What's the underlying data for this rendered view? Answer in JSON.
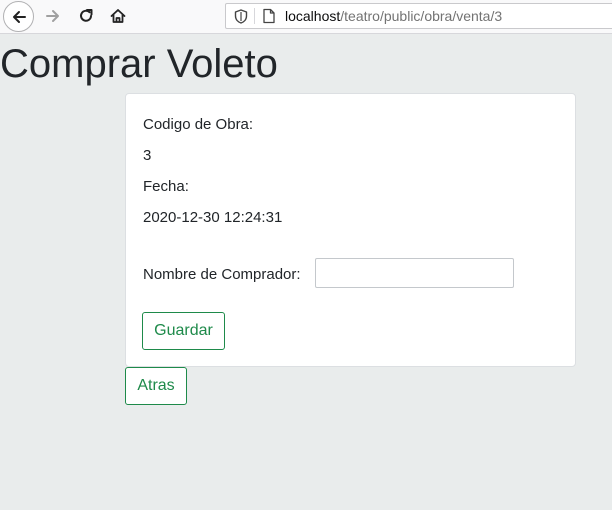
{
  "browser": {
    "url_host": "localhost",
    "url_path": "/teatro/public/obra/venta/3",
    "icons": [
      "back-arrow-icon",
      "forward-arrow-icon",
      "reload-icon",
      "home-icon",
      "shield-icon",
      "page-icon"
    ]
  },
  "page": {
    "title": "Comprar Voleto"
  },
  "form": {
    "obra_label": "Codigo de Obra:",
    "obra_value": "3",
    "fecha_label": "Fecha:",
    "fecha_value": "2020-12-30 12:24:31",
    "buyer_label": "Nombre de Comprador:",
    "buyer_value": "",
    "save_label": "Guardar"
  },
  "actions": {
    "back_label": "Atras"
  },
  "colors": {
    "accent": "#1e8a4a",
    "background": "#e9ecec"
  }
}
